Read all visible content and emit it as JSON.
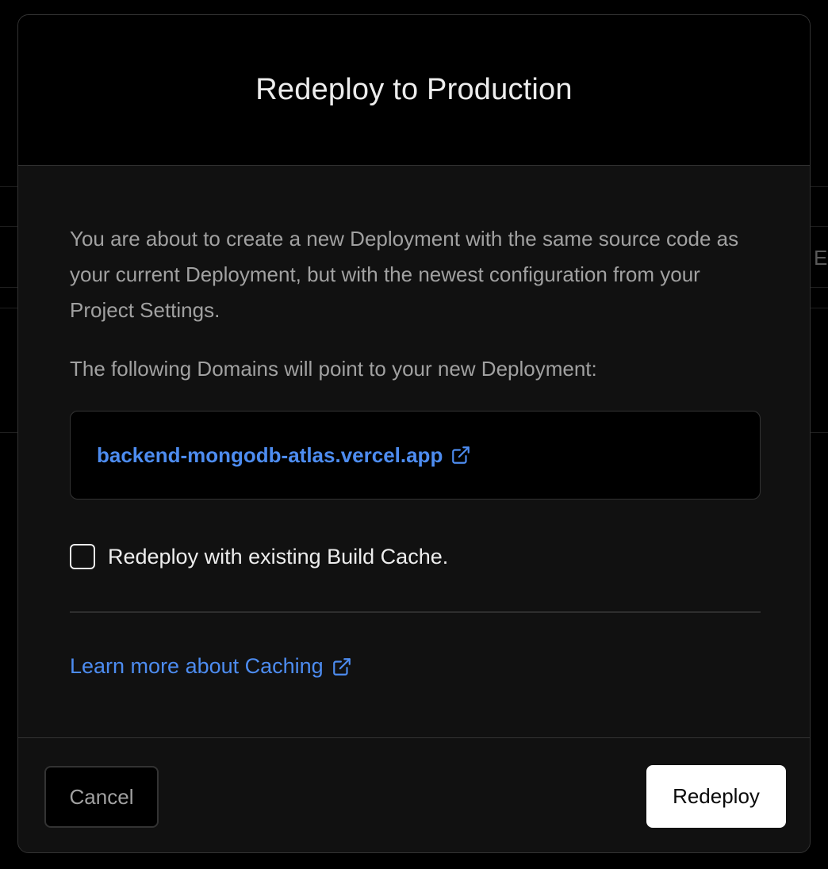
{
  "modal": {
    "title": "Redeploy to Production",
    "description": "You are about to create a new Deployment with the same source code as your current Deployment, but with the newest configuration from your Project Settings.",
    "domains_label": "The following Domains will point to your new Deployment:",
    "domains": [
      "backend-mongodb-atlas.vercel.app"
    ],
    "build_cache": {
      "label": "Redeploy with existing Build Cache.",
      "checked": false
    },
    "learn_more_label": "Learn more about Caching",
    "buttons": {
      "cancel_label": "Cancel",
      "redeploy_label": "Redeploy"
    }
  },
  "background": {
    "partial_text": "E"
  },
  "icons": {
    "external_link": "external-link-icon"
  },
  "colors": {
    "link": "#4d8cf0",
    "surface": "#111111",
    "header": "#000000",
    "border": "#333333"
  }
}
